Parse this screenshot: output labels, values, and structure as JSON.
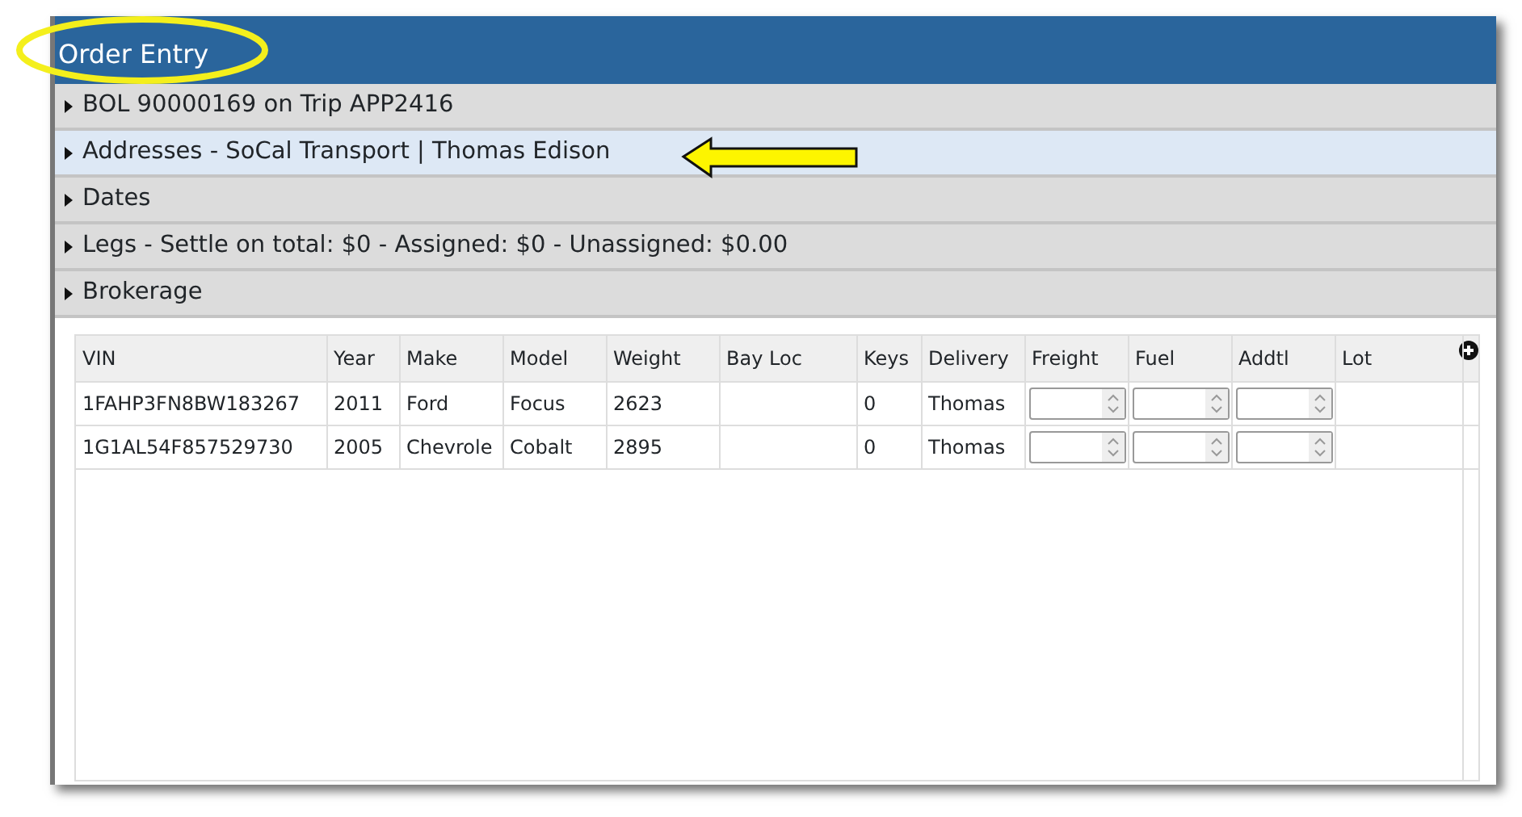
{
  "window": {
    "title": "Order Entry"
  },
  "sections": [
    {
      "label": "BOL 90000169 on Trip APP2416",
      "expanded": false,
      "selected": false
    },
    {
      "label": "Addresses - SoCal Transport | Thomas Edison",
      "expanded": false,
      "selected": true
    },
    {
      "label": "Dates",
      "expanded": false,
      "selected": false
    },
    {
      "label": "Legs - Settle on total: $0 - Assigned: $0 - Unassigned: $0.00",
      "expanded": false,
      "selected": false
    },
    {
      "label": "Brokerage",
      "expanded": false,
      "selected": false
    }
  ],
  "table": {
    "columns": [
      "VIN",
      "Year",
      "Make",
      "Model",
      "Weight",
      "Bay Loc",
      "Keys",
      "Delivery",
      "Freight",
      "Fuel",
      "Addtl",
      "Lot"
    ],
    "rows": [
      {
        "cells": [
          {
            "kind": "text",
            "text": "1FAHP3FN8BW183267"
          },
          {
            "kind": "text",
            "text": "2011"
          },
          {
            "kind": "text",
            "text": "Ford"
          },
          {
            "kind": "text",
            "text": "Focus"
          },
          {
            "kind": "text",
            "text": "2623"
          },
          {
            "kind": "text"
          },
          {
            "kind": "text",
            "text": "0"
          },
          {
            "kind": "text",
            "text": "Thomas"
          },
          {
            "kind": "number"
          },
          {
            "kind": "number"
          },
          {
            "kind": "number"
          },
          {
            "kind": "text"
          }
        ]
      },
      {
        "cells": [
          {
            "kind": "text",
            "text": "1G1AL54F857529730"
          },
          {
            "kind": "text",
            "text": "2005"
          },
          {
            "kind": "text",
            "text": "Chevrole"
          },
          {
            "kind": "text",
            "text": "Cobalt"
          },
          {
            "kind": "text",
            "text": "2895"
          },
          {
            "kind": "text"
          },
          {
            "kind": "text",
            "text": "0"
          },
          {
            "kind": "text",
            "text": "Thomas"
          },
          {
            "kind": "number"
          },
          {
            "kind": "number"
          },
          {
            "kind": "number"
          },
          {
            "kind": "text"
          }
        ]
      }
    ]
  }
}
